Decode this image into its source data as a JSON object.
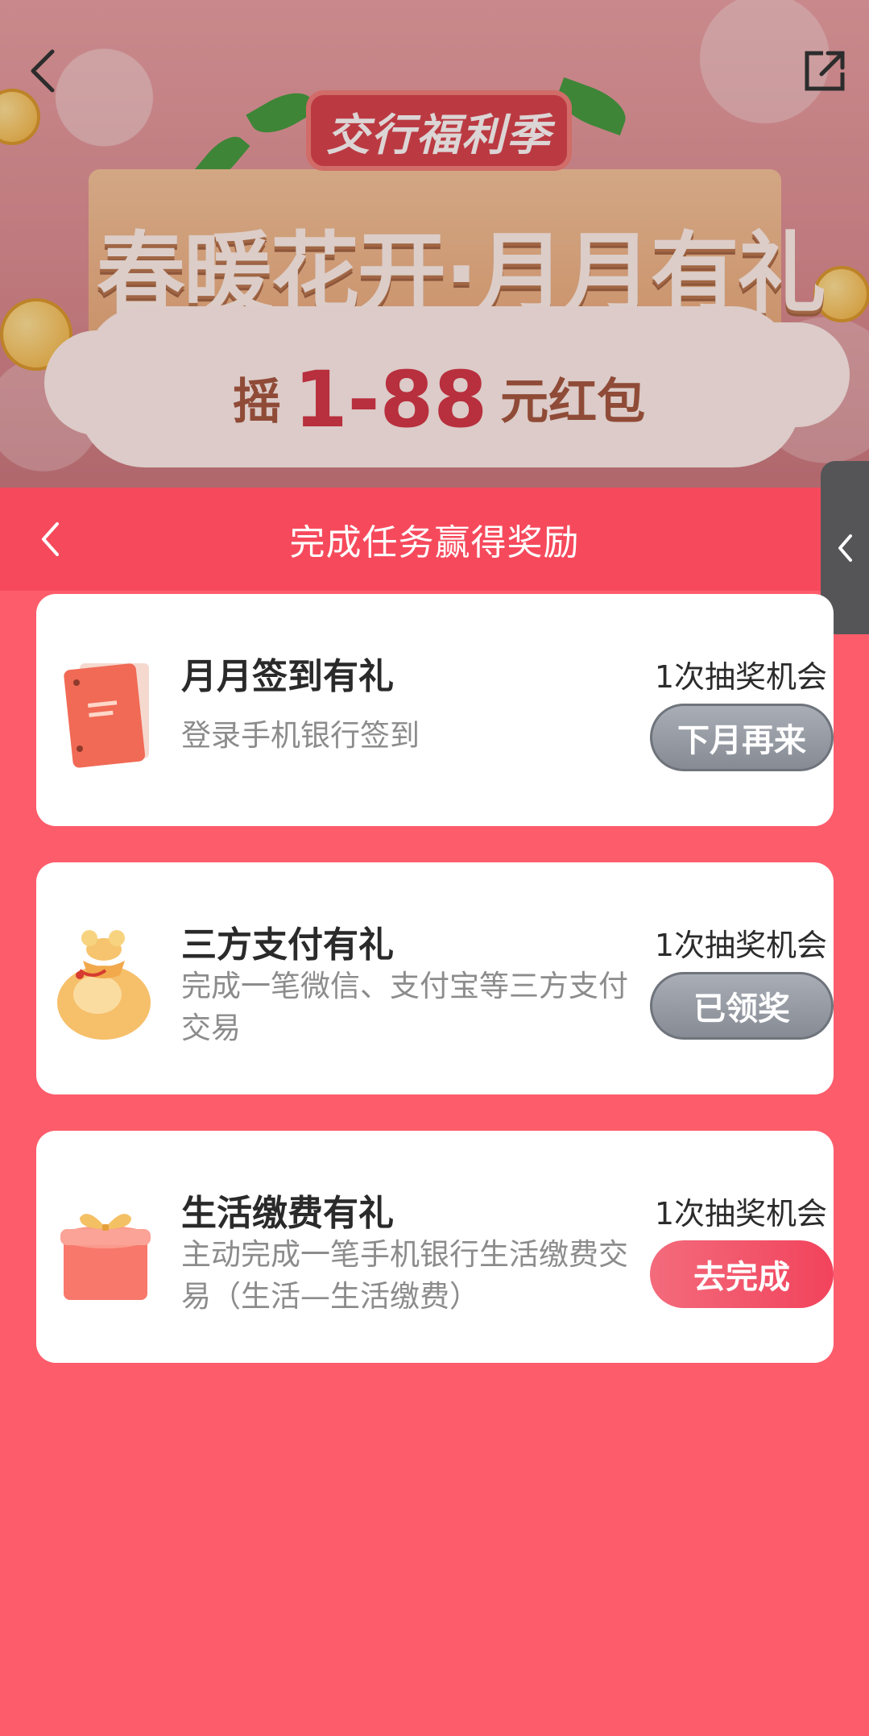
{
  "banner": {
    "badge": "交行福利季",
    "title": "春暖花开·月月有礼",
    "subtitle_prefix": "摇",
    "subtitle_amount": "1-88",
    "subtitle_suffix": "元红包"
  },
  "nav": {
    "back_icon": "chevron-left-icon",
    "share_icon": "share-external-icon"
  },
  "task_panel": {
    "title": "完成任务赢得奖励"
  },
  "tasks": [
    {
      "name": "月月签到有礼",
      "description": "登录手机银行签到",
      "chance": "1次抽奖机会",
      "button": "下月再来",
      "button_state": "disabled",
      "icon": "folder-icon"
    },
    {
      "name": "三方支付有礼",
      "description": "完成一笔微信、支付宝等三方支付交易",
      "chance": "1次抽奖机会",
      "button": "已领奖",
      "button_state": "disabled",
      "icon": "money-bag-icon"
    },
    {
      "name": "生活缴费有礼",
      "description": "主动完成一笔手机银行生活缴费交易（生活—生活缴费）",
      "chance": "1次抽奖机会",
      "button": "去完成",
      "button_state": "active",
      "icon": "gift-box-icon"
    }
  ],
  "colors": {
    "page_bg": "#fd5c6b",
    "header_bg": "#f64a5c",
    "button_grey": "#8d929a",
    "button_active": "#f2435c"
  }
}
